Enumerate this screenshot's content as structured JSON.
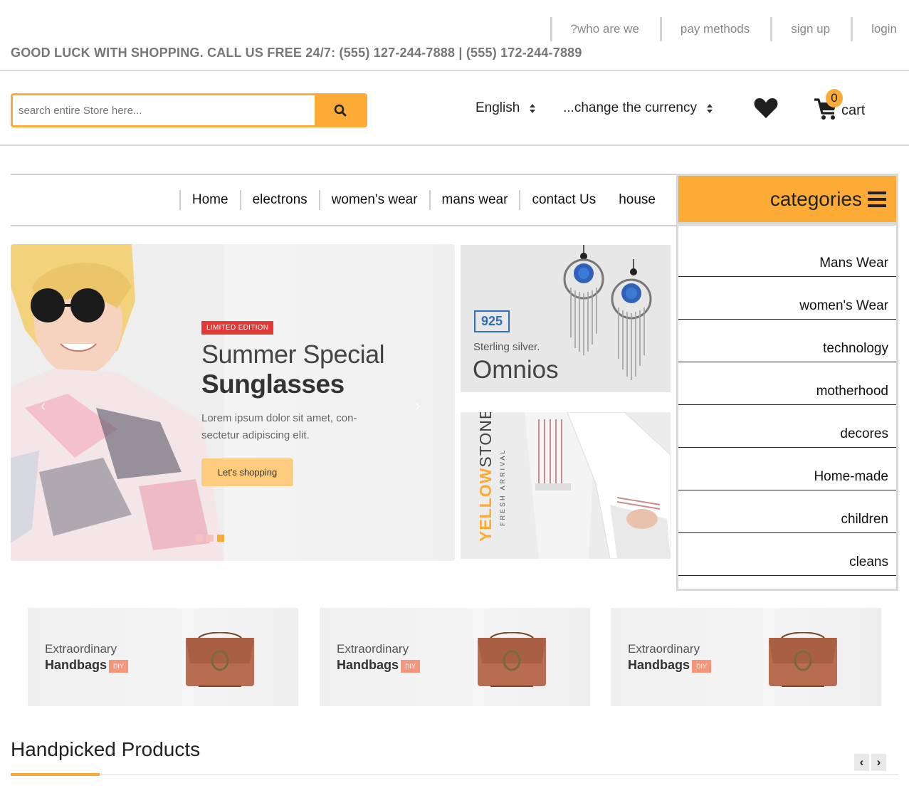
{
  "top_links": [
    "?who are we",
    "pay methods",
    "sign up",
    "login"
  ],
  "tagline": "GOOD LUCK WITH SHOPPING. CALL US FREE 24/7: (555) 127-244-7888 | (555) 172-244-7889",
  "search": {
    "placeholder": "search entire Store here...",
    "button_icon": "search-icon"
  },
  "language": {
    "selected": "English"
  },
  "currency": {
    "selected": "...change the currency"
  },
  "wishlist": {
    "icon": "heart-icon"
  },
  "cart": {
    "count": "0",
    "label": "cart",
    "icon": "cart-icon"
  },
  "nav": [
    "Home",
    "electrons",
    "women's wear",
    "mans wear",
    "contact Us",
    "house"
  ],
  "categories": {
    "title": "categories",
    "items": [
      "Mans Wear",
      "women's Wear",
      "technology",
      "motherhood",
      "decores",
      "Home-made",
      "children",
      "cleans"
    ]
  },
  "hero": {
    "badge": "LIMITED EDITION",
    "title1": "Summer Special",
    "title2": "Sunglasses",
    "description": "Lorem ipsum dolor sit amet, con-sectetur adipiscing elit.",
    "button": "Let's shopping",
    "slides_total": 3,
    "active_slide": 3
  },
  "banner_silver": {
    "badge": "925",
    "subtitle": "Sterling silver.",
    "title": "Omnios"
  },
  "banner_yellowstone": {
    "brand_a": "YELLOW",
    "brand_b": "STONE",
    "tagline": "FRESH ARRIVAL"
  },
  "promos": [
    {
      "line1": "Extraordinary",
      "line2": "Handbags",
      "tag": "DIY"
    },
    {
      "line1": "Extraordinary",
      "line2": "Handbags",
      "tag": "DIY"
    },
    {
      "line1": "Extraordinary",
      "line2": "Handbags",
      "tag": "DIY"
    }
  ],
  "handpicked": {
    "title": "Handpicked Products",
    "prev_icon": "chevron-left-icon",
    "next_icon": "chevron-right-icon"
  },
  "colors": {
    "accent": "#fbab36",
    "badge_red": "#e53935",
    "silver_blue": "#2d6fb7",
    "diy": "#f5967a"
  }
}
